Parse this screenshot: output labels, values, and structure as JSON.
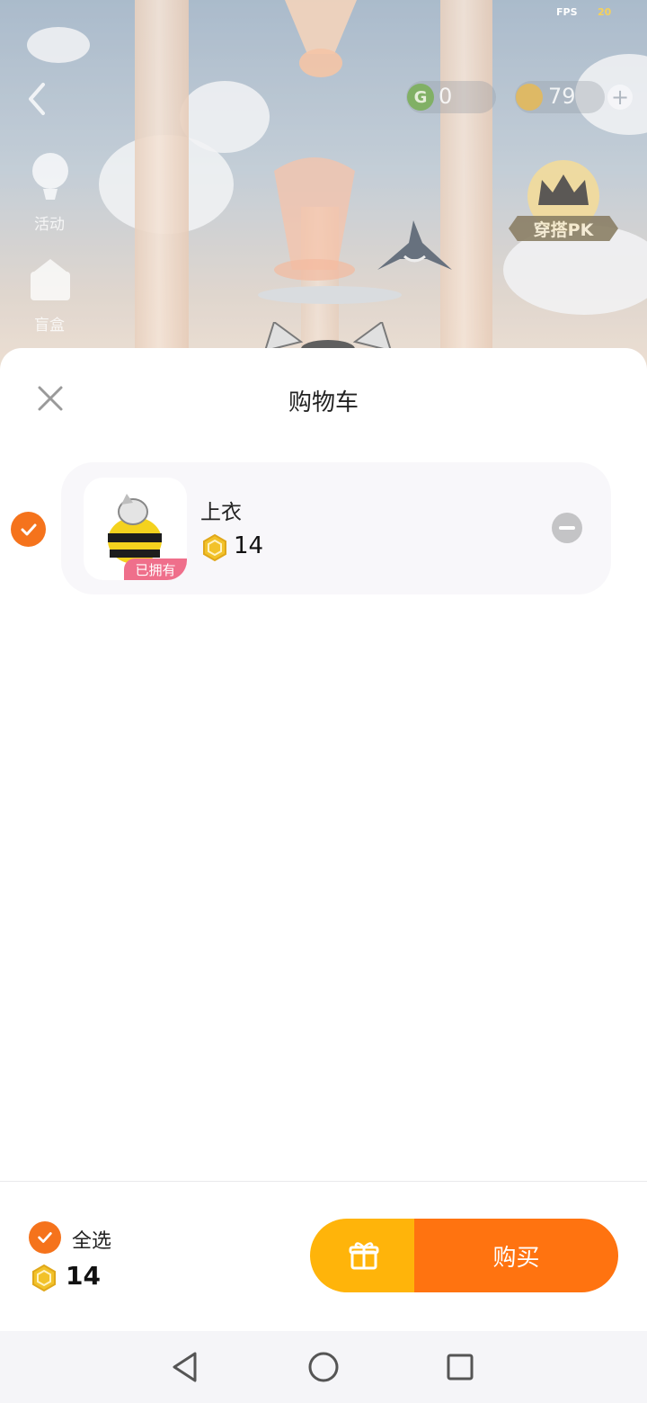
{
  "status": {
    "fps_label": "FPS",
    "fps_value": "20"
  },
  "hud": {
    "g_coin_symbol": "G",
    "g_coin_value": "0",
    "gold_coin_value": "79",
    "plus": "+"
  },
  "sidebar": {
    "items": [
      {
        "label": "活动",
        "icon": "balloon-icon"
      },
      {
        "label": "盲盒",
        "icon": "blind-box-icon"
      }
    ]
  },
  "pk_badge": {
    "label": "穿搭PK",
    "icon": "crown-icon"
  },
  "cart": {
    "title": "购物车",
    "items": [
      {
        "name": "上衣",
        "price": "14",
        "tag": "已拥有",
        "selected": true
      }
    ]
  },
  "footer": {
    "select_all_label": "全选",
    "total_price": "14",
    "buy_label": "购买",
    "gift_icon": "gift-icon"
  },
  "colors": {
    "accent_orange": "#ff7310",
    "gift_yellow": "#ffb40a",
    "owned_tag": "#ef6f8b",
    "check_orange": "#f5731c"
  },
  "navbar": {
    "items": [
      "back-triangle-icon",
      "home-circle-icon",
      "recents-square-icon"
    ]
  }
}
